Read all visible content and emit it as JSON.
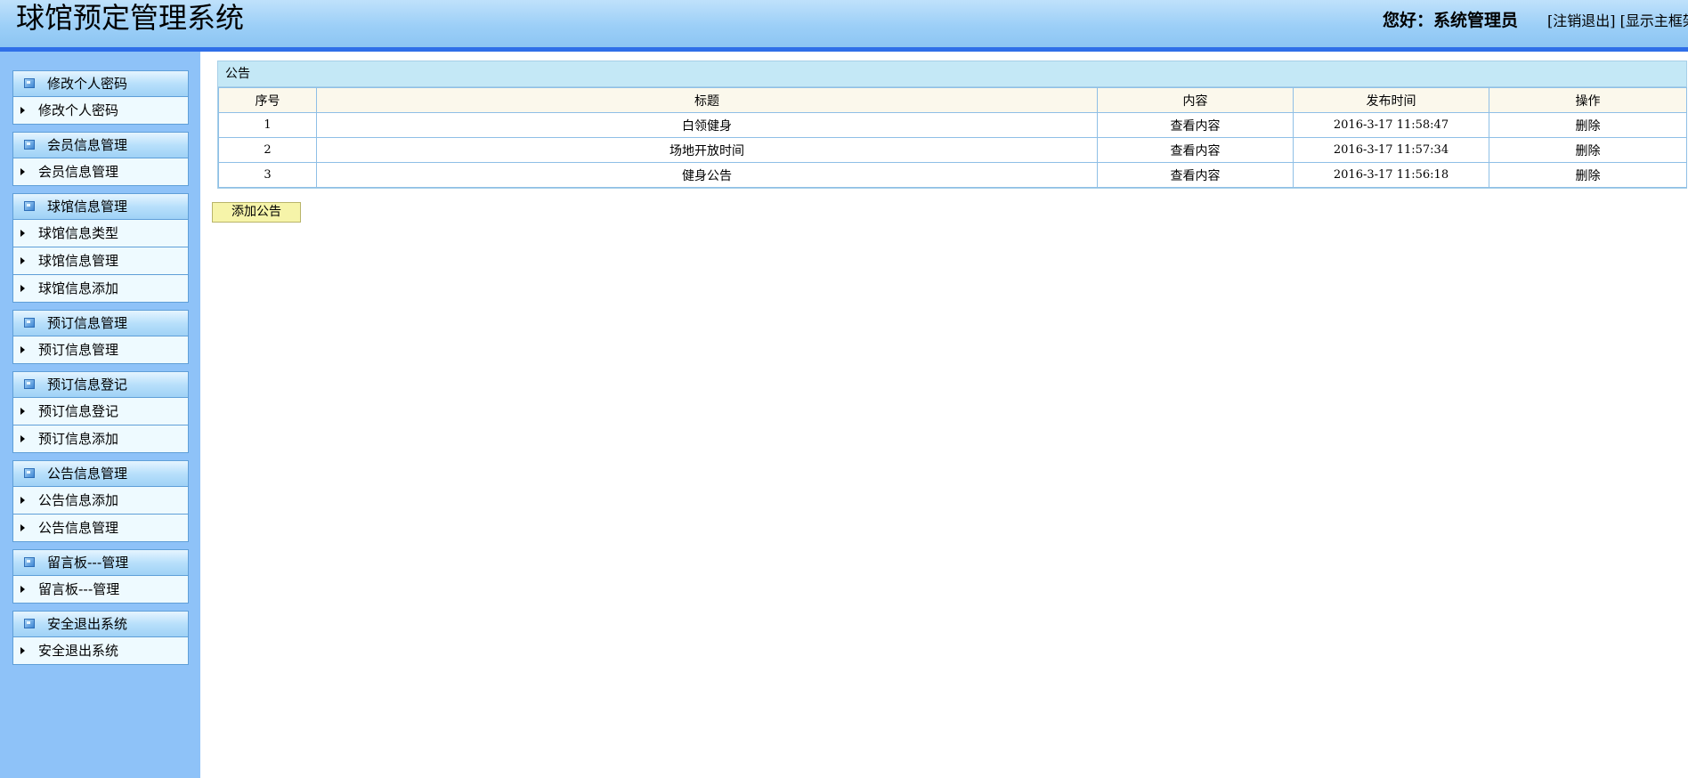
{
  "header": {
    "title": "球馆预定管理系统",
    "welcome": "您好：系统管理员",
    "logout_label": "[注销退出]",
    "show_main_label": "[显示主框架]"
  },
  "sidebar": {
    "groups": [
      {
        "title": "修改个人密码",
        "items": [
          "修改个人密码"
        ]
      },
      {
        "title": "会员信息管理",
        "items": [
          "会员信息管理"
        ]
      },
      {
        "title": "球馆信息管理",
        "items": [
          "球馆信息类型",
          "球馆信息管理",
          "球馆信息添加"
        ]
      },
      {
        "title": "预订信息管理",
        "items": [
          "预订信息管理"
        ]
      },
      {
        "title": "预订信息登记",
        "items": [
          "预订信息登记",
          "预订信息添加"
        ]
      },
      {
        "title": "公告信息管理",
        "items": [
          "公告信息添加",
          "公告信息管理"
        ]
      },
      {
        "title": "留言板---管理",
        "items": [
          "留言板---管理"
        ]
      },
      {
        "title": "安全退出系统",
        "items": [
          "安全退出系统"
        ]
      }
    ]
  },
  "main": {
    "panel_title": "公告",
    "columns": [
      "序号",
      "标题",
      "内容",
      "发布时间",
      "操作"
    ],
    "rows": [
      {
        "index": "1",
        "title": "白领健身",
        "content": "查看内容",
        "time": "2016-3-17 11:58:47",
        "action": "删除"
      },
      {
        "index": "2",
        "title": "场地开放时间",
        "content": "查看内容",
        "time": "2016-3-17 11:57:34",
        "action": "删除"
      },
      {
        "index": "3",
        "title": "健身公告",
        "content": "查看内容",
        "time": "2016-3-17 11:56:18",
        "action": "删除"
      }
    ],
    "add_button_label": "添加公告"
  },
  "colors": {
    "header_gradient_top": "#bfe1fb",
    "header_gradient_bottom": "#8cc5f3",
    "header_border": "#2f6fe8",
    "sidebar_background": "#8ec2f8",
    "menu_item_background": "#eefaff",
    "panel_title_background": "#c4e8f6",
    "table_header_background": "#fbf8ec",
    "add_button_background": "#f6f4a9"
  },
  "icons": {
    "menu_head_icon": "square-window-icon",
    "menu_item_icon": "triangle-right-arrow-icon"
  }
}
